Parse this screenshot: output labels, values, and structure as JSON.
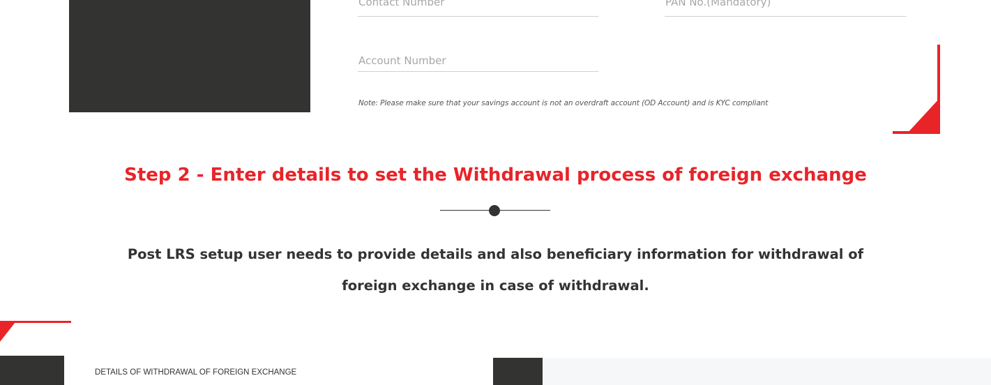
{
  "form": {
    "contact_number": "Contact Number",
    "pan_number": "PAN No.(Mandatory)",
    "account_number": "Account Number",
    "note": "Note: Please make sure that your savings account is not an overdraft account (OD Account) and is KYC compliant"
  },
  "step2": {
    "title": "Step 2 - Enter details to set the Withdrawal process of foreign exchange",
    "description_line1": "Post LRS setup user needs to provide details and also beneficiary information for withdrawal of",
    "description_line2": "foreign exchange in case of withdrawal."
  },
  "lower_panel": {
    "title": "DETAILS OF WITHDRAWAL OF FOREIGN EXCHANGE"
  },
  "colors": {
    "accent_red": "#e82429",
    "dark_block": "#333331",
    "text_dark": "#333333",
    "placeholder": "#a7a7a7"
  }
}
